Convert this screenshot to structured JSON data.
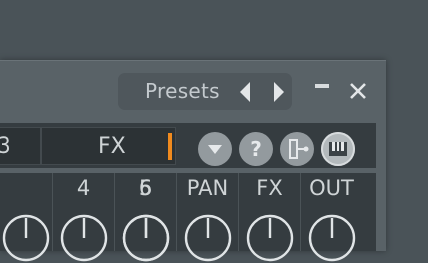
{
  "window": {
    "presets_label": "Presets",
    "minimize_icon": "minimize-icon",
    "close_icon": "close-icon"
  },
  "toolbar": {
    "slot_number": "3",
    "fx_label": "FX",
    "accent_color": "#f08a1e",
    "buttons": [
      "menu-arrow-icon",
      "help-icon",
      "routing-icon",
      "piano-icon"
    ]
  },
  "mixer": {
    "columns": [
      "",
      "4",
      "5",
      "6",
      "PAN",
      "FX",
      "OUT"
    ]
  }
}
